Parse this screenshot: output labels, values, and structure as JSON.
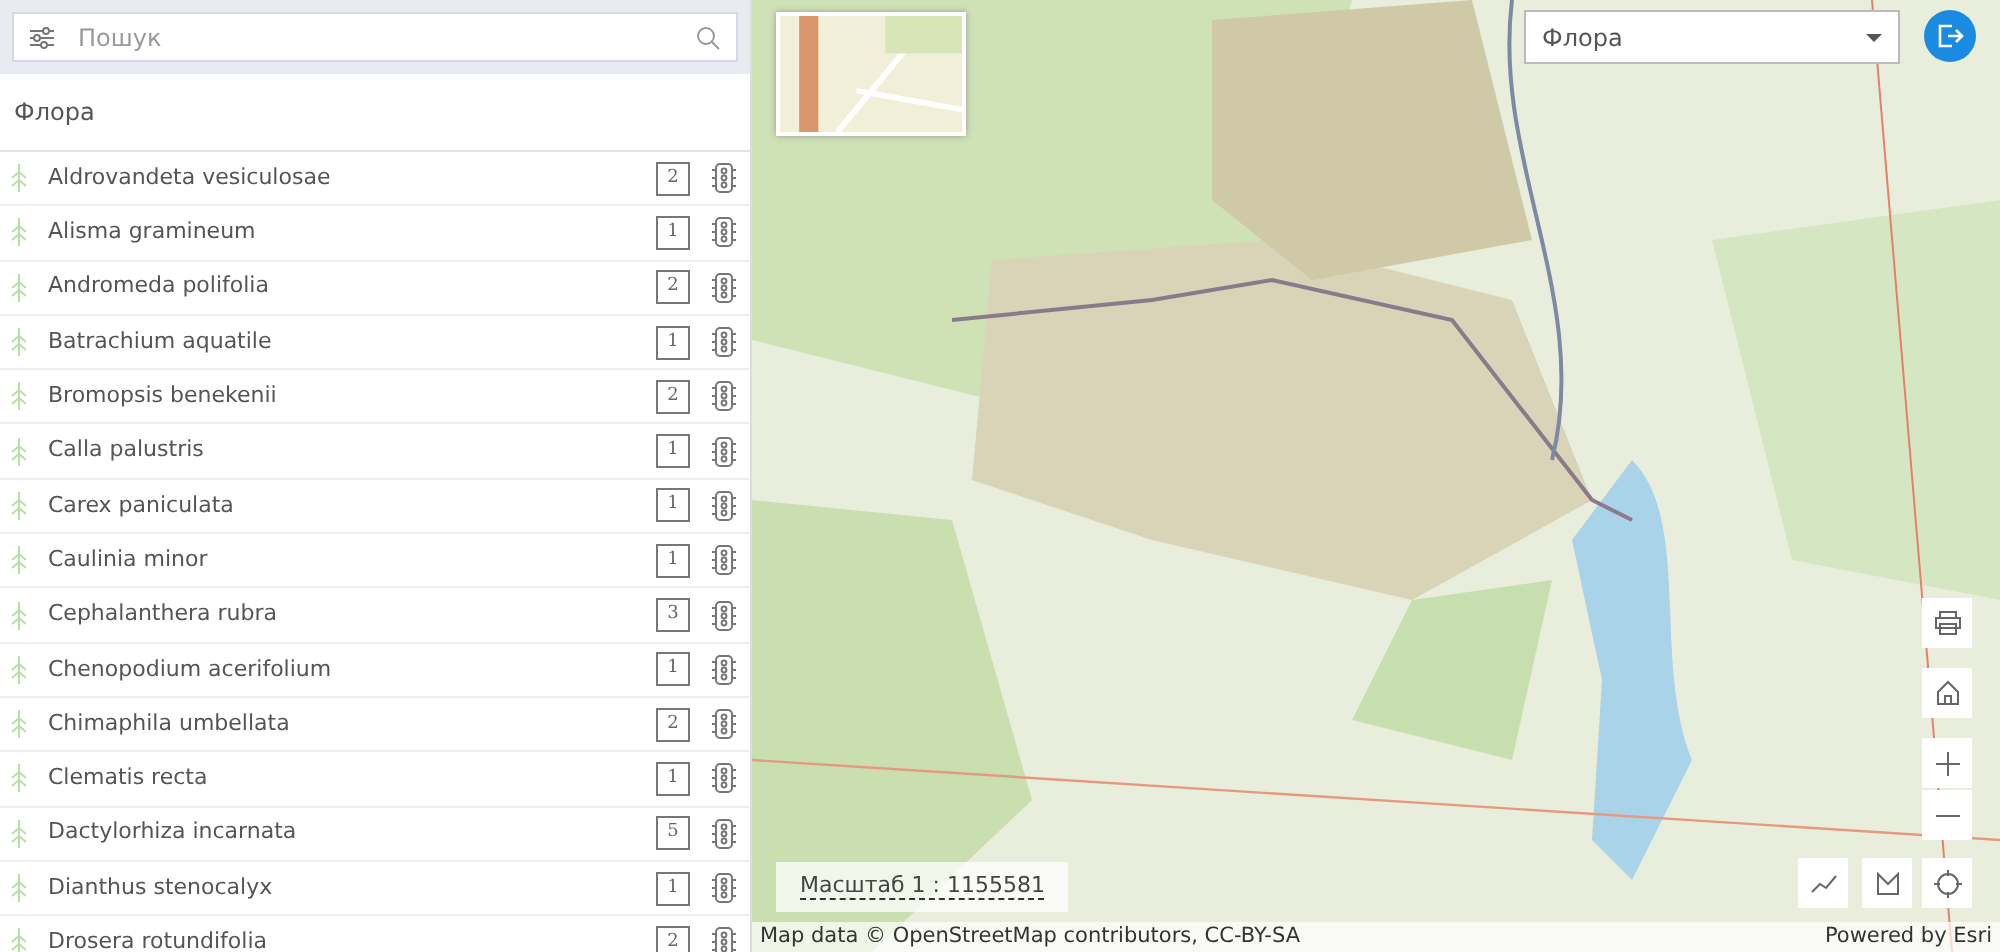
{
  "search": {
    "placeholder": "Пошук"
  },
  "list_title": "Флора",
  "species": [
    {
      "name": "Aldrovandeta vesiculosae",
      "count": "2"
    },
    {
      "name": "Alisma gramineum",
      "count": "1"
    },
    {
      "name": "Andromeda polifolia",
      "count": "2"
    },
    {
      "name": "Batrachium aquatile",
      "count": "1"
    },
    {
      "name": "Bromopsis benekenii",
      "count": "2"
    },
    {
      "name": "Calla palustris",
      "count": "1"
    },
    {
      "name": "Carex paniculata",
      "count": "1"
    },
    {
      "name": "Caulinia minor",
      "count": "1"
    },
    {
      "name": "Cephalanthera rubra",
      "count": "3"
    },
    {
      "name": "Chenopodium acerifolium",
      "count": "1"
    },
    {
      "name": "Chimaphila umbellata",
      "count": "2"
    },
    {
      "name": "Clematis recta",
      "count": "1"
    },
    {
      "name": "Dactylorhiza incarnata",
      "count": "5"
    },
    {
      "name": "Dianthus stenocalyx",
      "count": "1"
    },
    {
      "name": "Drosera rotundifolia",
      "count": "2"
    }
  ],
  "map": {
    "kind": "picture",
    "layer_select": "Флора",
    "scale": "Масштаб 1 : 1155581",
    "attribution": "Map data © OpenStreetMap contributors, CC-BY-SA",
    "powered_by": "Powered by Esri"
  }
}
